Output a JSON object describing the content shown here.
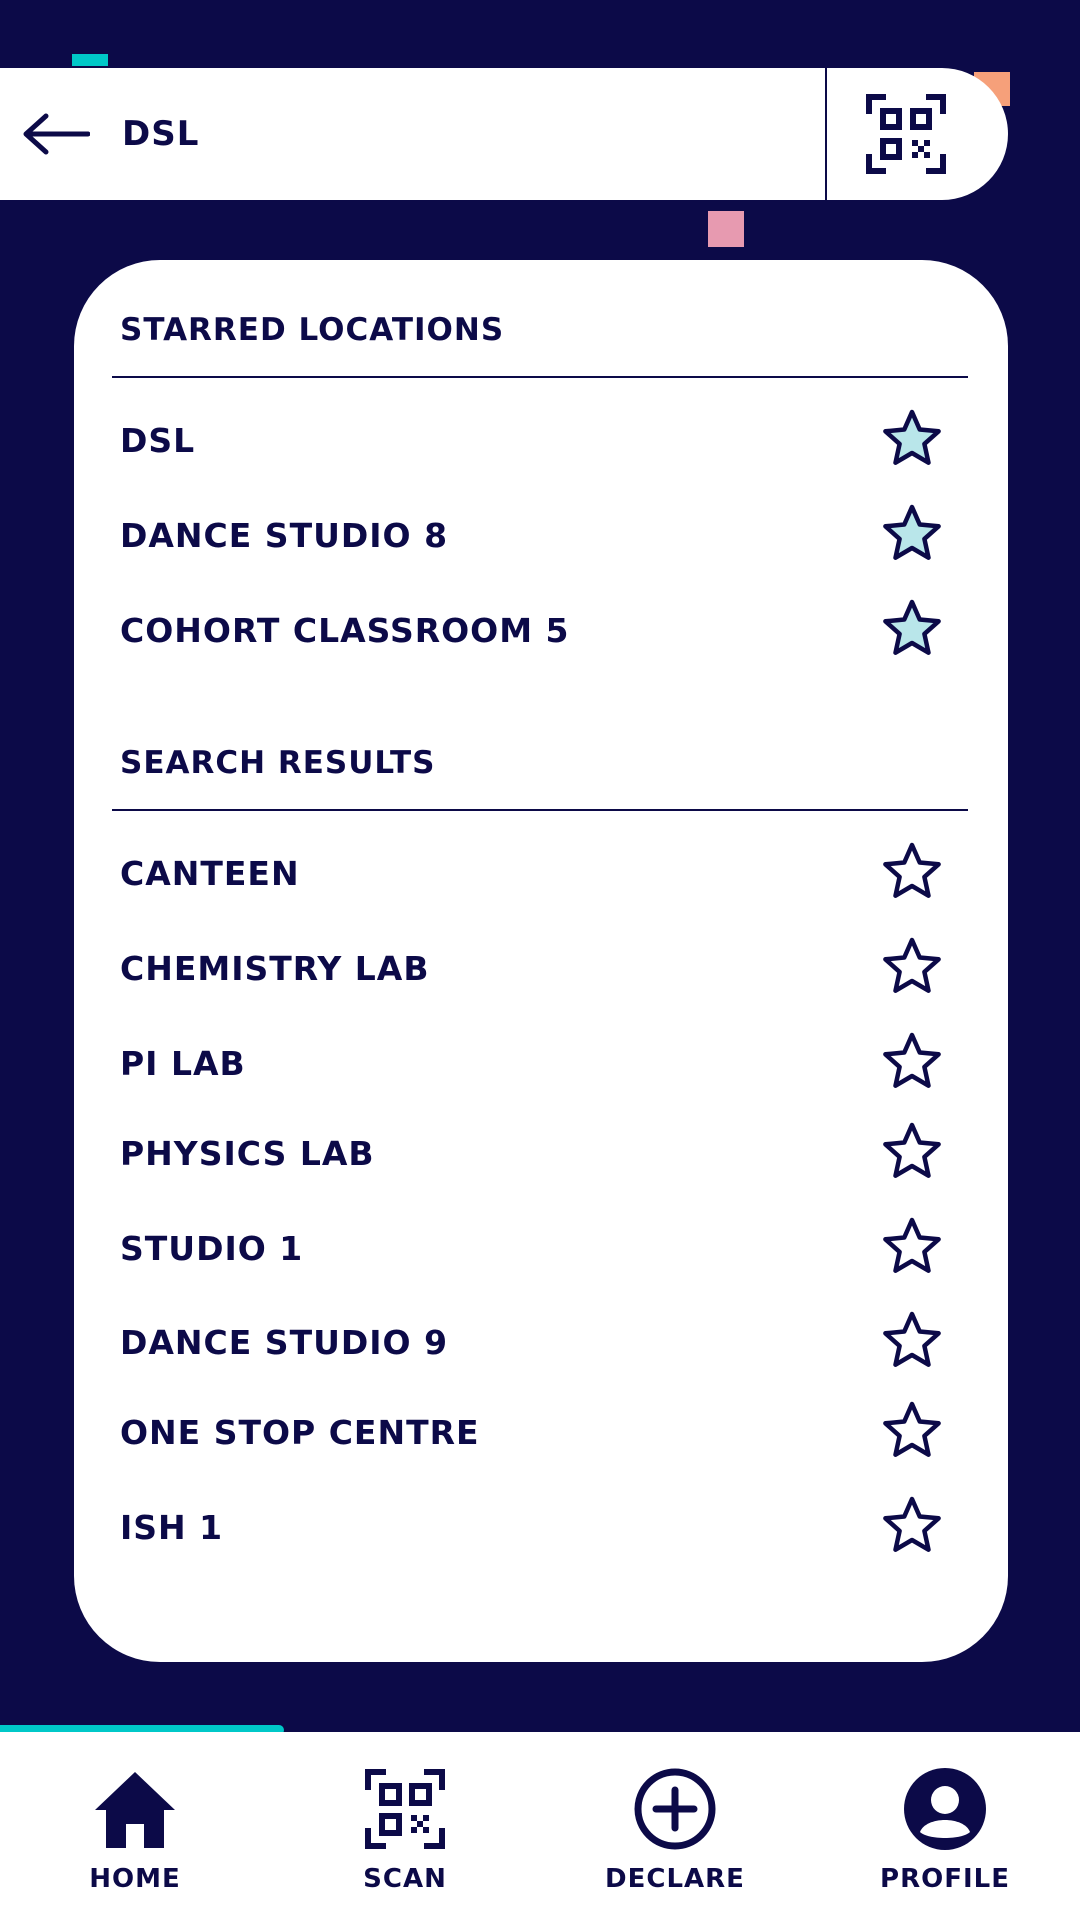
{
  "header": {
    "title": "DSL"
  },
  "starred": {
    "title": "STARRED LOCATIONS",
    "items": [
      {
        "label": "DSL",
        "starred": true
      },
      {
        "label": "DANCE STUDIO 8",
        "starred": true
      },
      {
        "label": "COHORT CLASSROOM 5",
        "starred": true
      }
    ]
  },
  "results": {
    "title": "SEARCH RESULTS",
    "items": [
      {
        "label": "CANTEEN",
        "starred": false
      },
      {
        "label": "CHEMISTRY LAB",
        "starred": false
      },
      {
        "label": "PI LAB",
        "starred": false
      },
      {
        "label": "PHYSICS LAB",
        "starred": false
      },
      {
        "label": "STUDIO 1",
        "starred": false
      },
      {
        "label": "DANCE STUDIO 9",
        "starred": false
      },
      {
        "label": "ONE STOP CENTRE",
        "starred": false
      },
      {
        "label": "ISH 1",
        "starred": false
      }
    ]
  },
  "nav": {
    "home": "HOME",
    "scan": "SCAN",
    "declare": "DECLARE",
    "profile": "PROFILE"
  },
  "colors": {
    "navy": "#0c0a48",
    "teal": "#00c8c8",
    "star_fill": "#b9e6ea",
    "orange": "#f6a07a",
    "pink": "#e79ab0"
  },
  "icons": {
    "back": "arrow-left-icon",
    "qr": "qr-code-icon",
    "star": "star-icon",
    "home": "home-icon",
    "scan": "qr-code-icon",
    "declare": "plus-circle-icon",
    "profile": "user-circle-icon"
  }
}
